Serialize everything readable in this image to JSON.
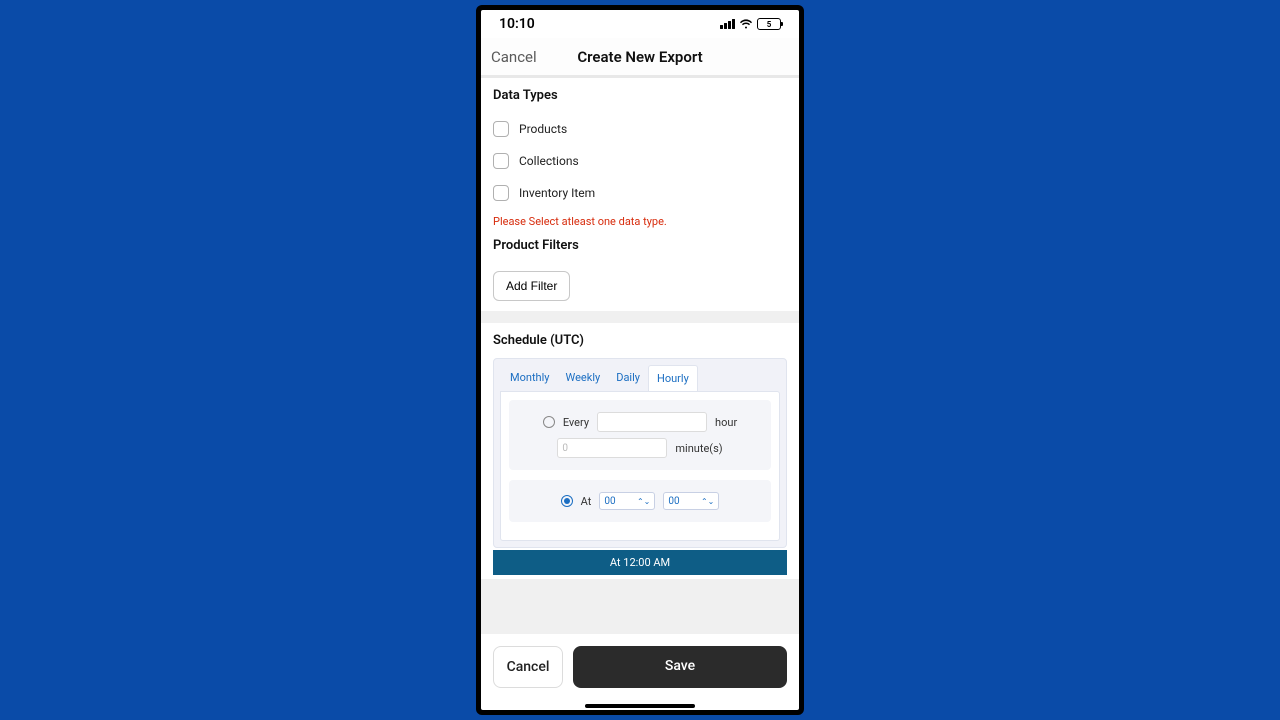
{
  "status": {
    "time": "10:10",
    "battery": "5"
  },
  "nav": {
    "cancel": "Cancel",
    "title": "Create New Export"
  },
  "dataTypes": {
    "title": "Data Types",
    "items": [
      "Products",
      "Collections",
      "Inventory Item"
    ],
    "error": "Please Select atleast one data type."
  },
  "filters": {
    "title": "Product Filters",
    "add": "Add Filter"
  },
  "schedule": {
    "title": "Schedule (UTC)",
    "tabs": [
      "Monthly",
      "Weekly",
      "Daily",
      "Hourly"
    ],
    "activeTab": "Hourly",
    "every": {
      "label": "Every",
      "unitHour": "hour",
      "minutePlaceholder": "0",
      "unitMin": "minute(s)"
    },
    "at": {
      "label": "At",
      "hourSel": "00",
      "minSel": "00"
    },
    "summary": "At 12:00 AM"
  },
  "footer": {
    "cancel": "Cancel",
    "save": "Save"
  }
}
